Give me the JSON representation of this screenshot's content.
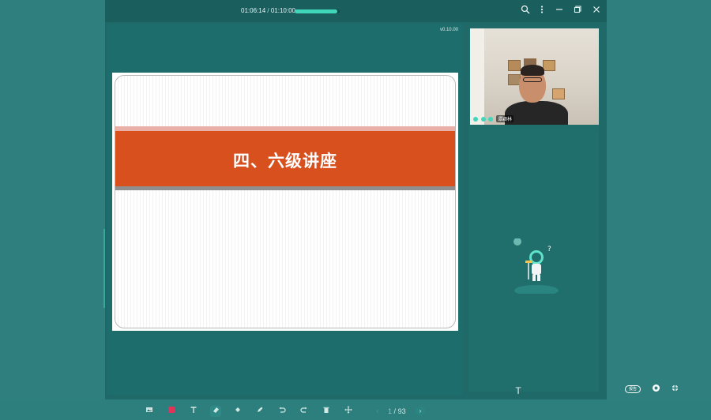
{
  "player": {
    "elapsed": "01:06:14",
    "separator": "/",
    "total": "01:10:00",
    "progress_fraction": 0.95
  },
  "window_controls": {
    "search_icon": "search-icon",
    "more_icon": "more-icon",
    "minimize_icon": "minimize-icon",
    "restore_icon": "restore-icon",
    "close_icon": "close-icon"
  },
  "main": {
    "version": "v0.10.00",
    "slide_title": "四、六级讲座"
  },
  "toolbar": {
    "tools": [
      "image-icon",
      "color-swatch",
      "text-icon",
      "eraser-icon",
      "fill-icon",
      "highlighter-icon",
      "undo-icon",
      "redo-icon",
      "delete-icon",
      "move-icon"
    ],
    "page_current": "1",
    "page_separator": "/",
    "page_total": "93"
  },
  "camera": {
    "name": "谭颖林"
  },
  "right_panel": {
    "report_label": "报告"
  }
}
